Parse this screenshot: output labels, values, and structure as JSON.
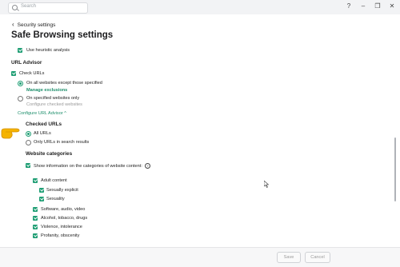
{
  "search": {
    "placeholder": "Search"
  },
  "window_controls": {
    "help": "?",
    "minimize": "–",
    "restore": "❐",
    "close": "✕"
  },
  "back": {
    "label": "Security settings"
  },
  "page": {
    "title": "Safe Browsing settings"
  },
  "heuristic": {
    "label": "Use heuristic analysis",
    "checked": true
  },
  "url_advisor": {
    "heading": "URL Advisor",
    "check_urls": {
      "label": "Check URLs",
      "checked": true
    },
    "option_all": {
      "label": "On all websites except those specified",
      "selected": true
    },
    "manage_exclusions": "Manage exclusions",
    "option_specified": {
      "label": "On specified websites only",
      "selected": false
    },
    "configure_checked": "Configure checked websites",
    "configure_link": "Configure URL Advisor",
    "configure_chevron": "^"
  },
  "checked_urls": {
    "heading": "Checked URLs",
    "all_urls": {
      "label": "All URLs",
      "selected": true
    },
    "only_search": {
      "label": "Only URLs in search results",
      "selected": false
    }
  },
  "website_categories": {
    "heading": "Website categories",
    "show_info": {
      "label": "Show information on the categories of website content:",
      "checked": true
    },
    "info_icon": "?",
    "items": [
      {
        "label": "Adult content",
        "checked": true
      },
      {
        "label": "Sexually explicit",
        "checked": true
      },
      {
        "label": "Sexuality",
        "checked": true
      },
      {
        "label": "Software, audio, video",
        "checked": true
      },
      {
        "label": "Alcohol, tobacco, drugs",
        "checked": true
      },
      {
        "label": "Violence, intolerance",
        "checked": true
      },
      {
        "label": "Profanity, obscenity",
        "checked": true
      }
    ]
  },
  "footer": {
    "save": "Save",
    "cancel": "Cancel"
  },
  "colors": {
    "accent": "#1f9e74",
    "pointer": "#f5b300"
  }
}
